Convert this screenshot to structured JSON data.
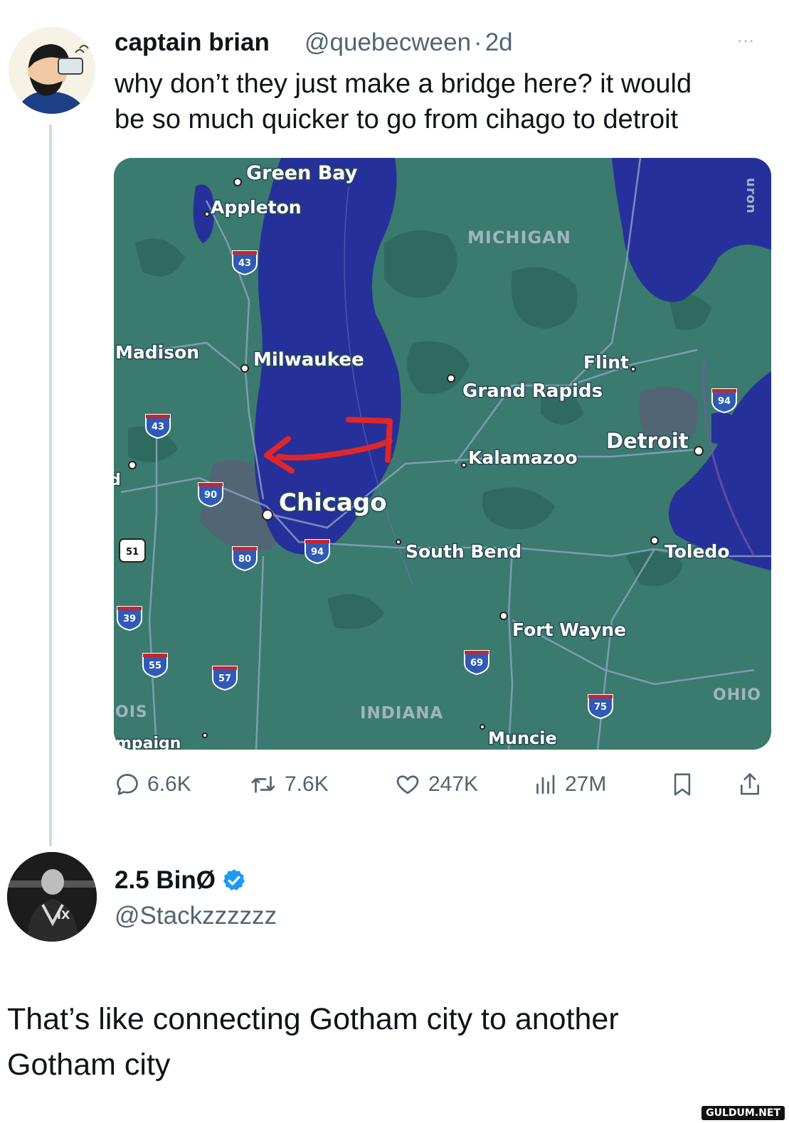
{
  "tweet": {
    "author_name": "captain brian",
    "handle": "@quebecween",
    "dot": "·",
    "time": "2d",
    "more_label": "···",
    "text_line1": "why don’t they just make a bridge here? it would",
    "text_line2": "be so much quicker to go from cihago to detroit",
    "actions": {
      "replies": "6.6K",
      "retweets": "7.6K",
      "likes": "247K",
      "views": "27M"
    }
  },
  "map": {
    "cities": {
      "green_bay": "Green Bay",
      "appleton": "Appleton",
      "madison": "Madison",
      "milwaukee": "Milwaukee",
      "chicago": "Chicago",
      "grand_rapids": "Grand Rapids",
      "flint": "Flint",
      "kalamazoo": "Kalamazoo",
      "detroit": "Detroit",
      "south_bend": "South Bend",
      "toledo": "Toledo",
      "fort_wayne": "Fort Wayne",
      "muncie": "Muncie",
      "champaign_partial": "mpaign",
      "partial_d": "d"
    },
    "states": {
      "michigan": "MICHIGAN",
      "indiana": "INDIANA",
      "ohio": "OHIO",
      "illinois_partial": "OIS",
      "huron_partial": "uron"
    },
    "shields": {
      "i43_north": "43",
      "i43_south": "43",
      "i90": "90",
      "us51": "51",
      "i80": "80",
      "i94_chicago": "94",
      "i94_detroit": "94",
      "i39": "39",
      "i55": "55",
      "i57": "57",
      "i69": "69",
      "i75": "75"
    },
    "colors": {
      "land": "#3b7a6e",
      "water": "#26309a",
      "arrow": "#e0262a"
    }
  },
  "reply": {
    "author_name": "2.5 BinØ",
    "handle": "@Stackzzzzzz",
    "text_line1": "That’s like connecting Gotham city to another",
    "text_line2": "Gotham city"
  },
  "watermark": "GULDUM.NET",
  "colors": {
    "verified": "#1d9bf0",
    "muted": "#536471",
    "thread_line": "#cfd9de"
  }
}
